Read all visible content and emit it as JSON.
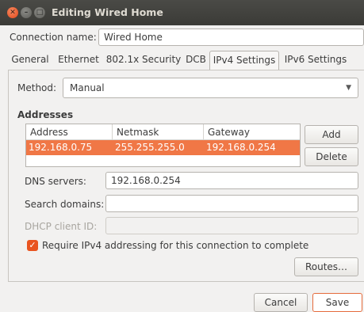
{
  "window": {
    "title": "Editing Wired Home",
    "close_glyph": "✕",
    "min_glyph": "–",
    "max_glyph": "□"
  },
  "connection": {
    "name_label": "Connection name:",
    "name_value": "Wired Home"
  },
  "tabs": [
    {
      "label": "General"
    },
    {
      "label": "Ethernet"
    },
    {
      "label": "802.1x Security"
    },
    {
      "label": "DCB"
    },
    {
      "label": "IPv4 Settings",
      "active": true
    },
    {
      "label": "IPv6 Settings"
    }
  ],
  "ipv4": {
    "method_label": "Method:",
    "method_value": "Manual",
    "method_arrow": "▼",
    "addresses_heading": "Addresses",
    "columns": [
      "Address",
      "Netmask",
      "Gateway"
    ],
    "rows": [
      {
        "address": "192.168.0.75",
        "netmask": "255.255.255.0",
        "gateway": "192.168.0.254",
        "selected": true
      }
    ],
    "add_label": "Add",
    "delete_label": "Delete",
    "dns_label": "DNS servers:",
    "dns_value": "192.168.0.254",
    "search_label": "Search domains:",
    "search_value": "",
    "dhcp_label": "DHCP client ID:",
    "dhcp_value": "",
    "require_label": "Require IPv4 addressing for this connection to complete",
    "require_checked": true,
    "check_glyph": "✓",
    "routes_label": "Routes…"
  },
  "footer": {
    "cancel_label": "Cancel",
    "save_label": "Save"
  },
  "colors": {
    "accent": "#e95420",
    "selection": "#f07746",
    "titlebar": "#3c3b37"
  }
}
